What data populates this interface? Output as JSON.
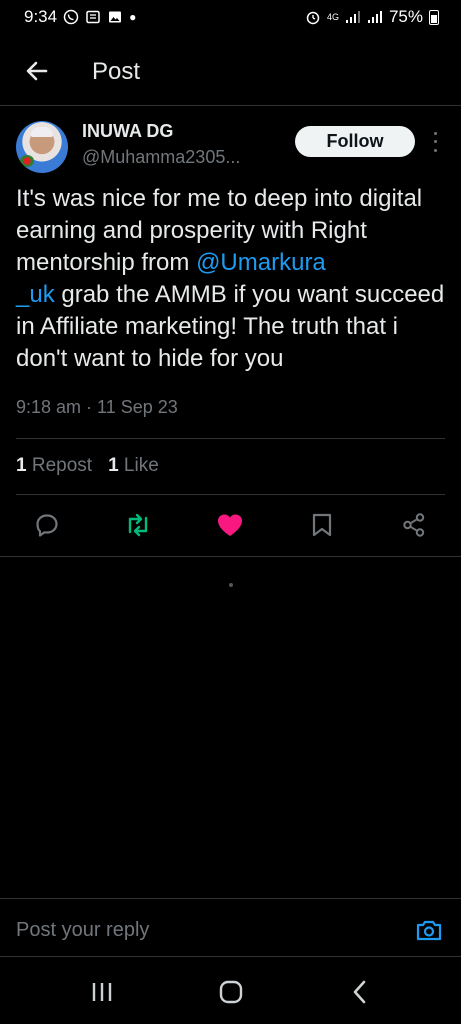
{
  "status_bar": {
    "time": "9:34",
    "network": "4G",
    "battery": "75%"
  },
  "header": {
    "title": "Post"
  },
  "post": {
    "display_name": "INUWA DG",
    "handle": "@Muhamma2305...",
    "follow_label": "Follow",
    "text_part1": "It's was nice for me to deep into digital earning and prosperity with Right mentorship from ",
    "mention": "@Umarkura_uk",
    "mention_line1": "@Umarkura",
    "mention_line2": "_uk",
    "text_part2": " grab the AMMB if you want succeed in Affiliate marketing! The truth that i don't want to hide for you",
    "timestamp": "9:18 am · 11 Sep 23",
    "repost_count": "1",
    "repost_label": "Repost",
    "like_count": "1",
    "like_label": "Like"
  },
  "actions": {
    "reply_icon": "reply-icon",
    "repost_icon": "repost-icon",
    "like_icon": "heart-icon",
    "bookmark_icon": "bookmark-icon",
    "share_icon": "share-icon"
  },
  "reply_bar": {
    "placeholder": "Post your reply"
  },
  "colors": {
    "accent": "#1d9bf0",
    "repost_green": "#00ba7c",
    "like_pink": "#f91880"
  }
}
